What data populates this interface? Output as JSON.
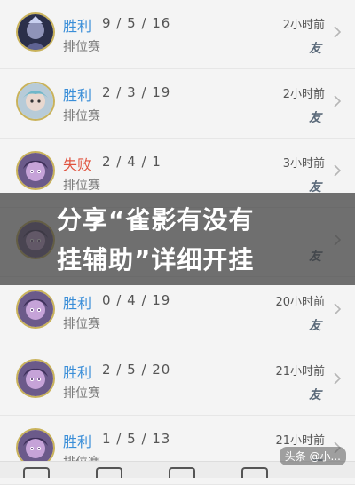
{
  "matches": [
    {
      "result": "胜利",
      "result_type": "win",
      "score": "9 / 5 / 16",
      "mode": "排位赛",
      "time": "2小时前",
      "badge": "友",
      "avatar": "hero-avatar-1"
    },
    {
      "result": "胜利",
      "result_type": "win",
      "score": "2 / 3 / 19",
      "mode": "排位赛",
      "time": "2小时前",
      "badge": "友",
      "avatar": "hero-avatar-2"
    },
    {
      "result": "失败",
      "result_type": "loss",
      "score": "2 / 4 / 1",
      "mode": "排位赛",
      "time": "3小时前",
      "badge": "友",
      "avatar": "hero-avatar-3"
    },
    {
      "result": "",
      "result_type": "win",
      "score": "",
      "mode": "",
      "time": "",
      "badge": "友",
      "avatar": "hero-avatar-3"
    },
    {
      "result": "胜利",
      "result_type": "win",
      "score": "0 / 4 / 19",
      "mode": "排位赛",
      "time": "20小时前",
      "badge": "友",
      "avatar": "hero-avatar-3"
    },
    {
      "result": "胜利",
      "result_type": "win",
      "score": "2 / 5 / 20",
      "mode": "排位赛",
      "time": "21小时前",
      "badge": "友",
      "avatar": "hero-avatar-3"
    },
    {
      "result": "胜利",
      "result_type": "win",
      "score": "1 / 5 / 13",
      "mode": "排位赛",
      "time": "21小时前",
      "badge": "友",
      "avatar": "hero-avatar-3"
    }
  ],
  "banner": {
    "line1": "分享“雀影有没有",
    "line2": "挂辅助”详细开挂"
  },
  "watermark": "头条 @小..."
}
